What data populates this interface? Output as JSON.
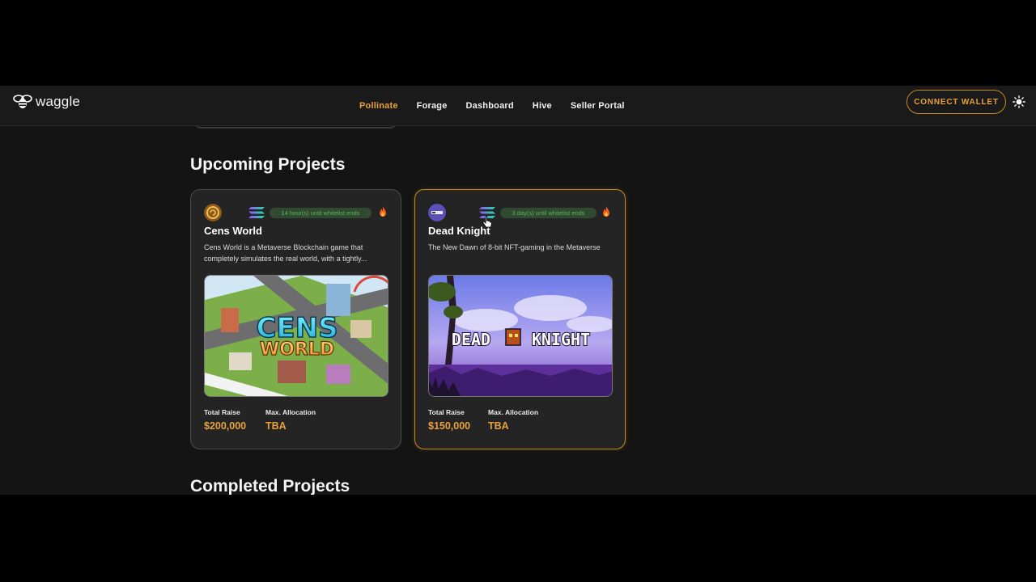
{
  "brand": {
    "name": "waggle"
  },
  "nav": {
    "items": [
      {
        "label": "Pollinate",
        "active": true
      },
      {
        "label": "Forage",
        "active": false
      },
      {
        "label": "Dashboard",
        "active": false
      },
      {
        "label": "Hive",
        "active": false
      },
      {
        "label": "Seller Portal",
        "active": false
      }
    ],
    "connect_label": "CONNECT WALLET",
    "theme_icon": "sun-icon"
  },
  "sections": {
    "upcoming_title": "Upcoming Projects",
    "completed_title": "Completed Projects"
  },
  "projects": [
    {
      "name": "Cens World",
      "description": "Cens World is a Metaverse Blockchain game that completely simulates the real world, with a tightly...",
      "badge": "14 hour(s) until whitelist ends",
      "chain_icon": "solana-icon",
      "status_icon": "fire-icon",
      "image_text_top": "CENS",
      "image_text_bottom": "WORLD",
      "stats": {
        "total_raise_label": "Total Raise",
        "total_raise": "$200,000",
        "max_alloc_label": "Max. Allocation",
        "max_alloc": "TBA"
      }
    },
    {
      "name": "Dead Knight",
      "description": "The New Dawn of 8-bit NFT-gaming in the Metaverse",
      "badge": "3 day(s) until whitelist ends",
      "chain_icon": "solana-icon",
      "status_icon": "fire-icon",
      "image_text_left": "DEAD",
      "image_text_right": "KNIGHT",
      "stats": {
        "total_raise_label": "Total Raise",
        "total_raise": "$150,000",
        "max_alloc_label": "Max. Allocation",
        "max_alloc": "TBA"
      }
    }
  ],
  "colors": {
    "accent": "#e8a13a",
    "background": "#141414",
    "card": "#242424",
    "badge_bg": "#2f4a2f",
    "badge_text": "#5fae5f"
  }
}
